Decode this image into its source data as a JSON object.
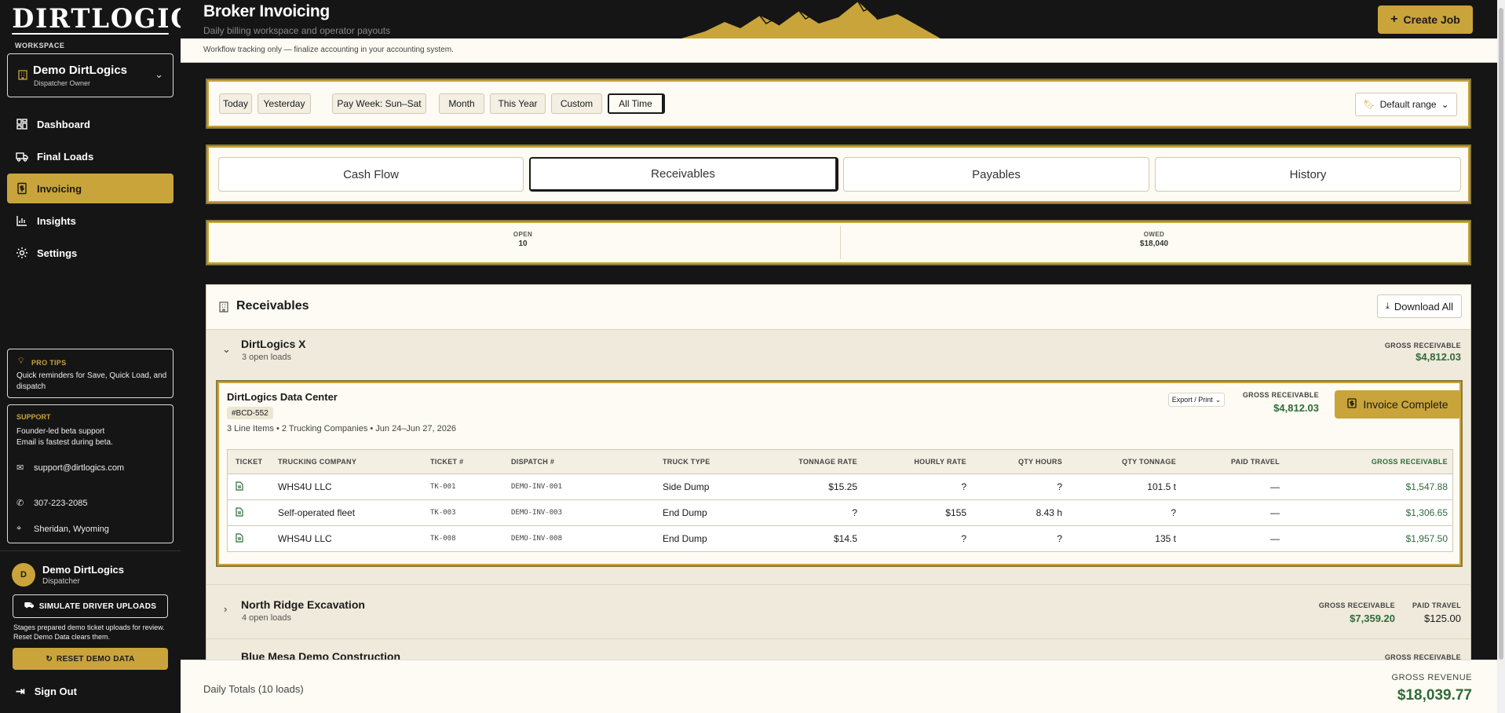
{
  "brand": {
    "logo": "DIRTLOGICS"
  },
  "workspace": {
    "label": "WORKSPACE",
    "name": "Demo DirtLogics",
    "role": "Dispatcher Owner"
  },
  "nav": [
    {
      "label": "Dashboard",
      "icon": "grid-icon"
    },
    {
      "label": "Final Loads",
      "icon": "truck-icon"
    },
    {
      "label": "Invoicing",
      "icon": "invoice-icon",
      "active": true
    },
    {
      "label": "Insights",
      "icon": "bar-chart-icon"
    },
    {
      "label": "Settings",
      "icon": "gear-icon"
    }
  ],
  "tips": {
    "title": "PRO TIPS",
    "text": "Quick reminders for Save, Quick Load, and dispatch"
  },
  "support": {
    "title": "SUPPORT",
    "line1": "Founder-led beta support",
    "line2": "Email is fastest during beta.",
    "email": "support@dirtlogics.com",
    "phone": "307-223-2085",
    "location": "Sheridan, Wyoming"
  },
  "user": {
    "initial": "D",
    "name": "Demo DirtLogics",
    "role": "Dispatcher"
  },
  "simulate": {
    "label": "SIMULATE DRIVER UPLOADS",
    "note": "Stages prepared demo ticket uploads for review. Reset Demo Data clears them."
  },
  "reset": {
    "label": "RESET DEMO DATA"
  },
  "signout": {
    "label": "Sign Out"
  },
  "header": {
    "title": "Broker Invoicing",
    "subtitle": "Daily billing workspace and operator payouts",
    "create_label": "Create Job",
    "notice": "Workflow tracking only — finalize accounting in your accounting system."
  },
  "ranges": {
    "chips": [
      "Today",
      "Yesterday",
      "Pay Week: Sun–Sat",
      "Month",
      "This Year",
      "Custom",
      "All Time"
    ],
    "active": "All Time",
    "default_label": "Default range"
  },
  "tabs": {
    "items": [
      "Cash Flow",
      "Receivables",
      "Payables",
      "History"
    ],
    "active": "Receivables"
  },
  "stats": {
    "open_label": "OPEN",
    "open_value": "10",
    "owed_label": "OWED",
    "owed_value": "$18,040"
  },
  "receivables": {
    "title": "Receivables",
    "download_label": "Download All",
    "groups": [
      {
        "name": "DirtLogics X",
        "count": "3 open loads",
        "gross_label": "GROSS RECEIVABLE",
        "gross": "$4,812.03"
      },
      {
        "name": "North Ridge Excavation",
        "count": "4 open loads",
        "gross_label": "GROSS RECEIVABLE",
        "gross": "$7,359.20",
        "travel_label": "PAID TRAVEL",
        "travel": "$125.00"
      },
      {
        "name": "Blue Mesa Demo Construction",
        "gross_label": "GROSS RECEIVABLE"
      }
    ],
    "invoice": {
      "name": "DirtLogics Data Center",
      "badge": "#BCD-552",
      "meta": "3 Line Items • 2 Trucking Companies • Jun 24–Jun 27, 2026",
      "export_label": "Export / Print",
      "gross_label": "GROSS RECEIVABLE",
      "gross": "$4,812.03",
      "complete_label": "Invoice Complete",
      "columns": [
        "TICKET",
        "TRUCKING COMPANY",
        "TICKET #",
        "DISPATCH #",
        "TRUCK TYPE",
        "TONNAGE RATE",
        "HOURLY RATE",
        "QTY HOURS",
        "QTY TONNAGE",
        "PAID TRAVEL",
        "GROSS RECEIVABLE"
      ],
      "rows": [
        {
          "company": "WHS4U LLC",
          "ticket": "TK-001",
          "dispatch": "DEMO-INV-001",
          "truck": "Side Dump",
          "tonnage_rate": "$15.25",
          "hourly_rate": "?",
          "qty_hours": "?",
          "qty_tonnage": "101.5 t",
          "travel": "—",
          "gross": "$1,547.88"
        },
        {
          "company": "Self-operated fleet",
          "ticket": "TK-003",
          "dispatch": "DEMO-INV-003",
          "truck": "End Dump",
          "tonnage_rate": "?",
          "hourly_rate": "$155",
          "qty_hours": "8.43 h",
          "qty_tonnage": "?",
          "travel": "—",
          "gross": "$1,306.65"
        },
        {
          "company": "WHS4U LLC",
          "ticket": "TK-008",
          "dispatch": "DEMO-INV-008",
          "truck": "End Dump",
          "tonnage_rate": "$14.5",
          "hourly_rate": "?",
          "qty_hours": "?",
          "qty_tonnage": "135 t",
          "travel": "—",
          "gross": "$1,957.50"
        }
      ]
    }
  },
  "footer": {
    "left": "Daily Totals (10 loads)",
    "label": "GROSS REVENUE",
    "value": "$18,039.77"
  },
  "colors": {
    "accent": "#c9a43a",
    "dark": "#151515",
    "positive": "#2f6b3a",
    "cream": "#fdfbf3"
  }
}
